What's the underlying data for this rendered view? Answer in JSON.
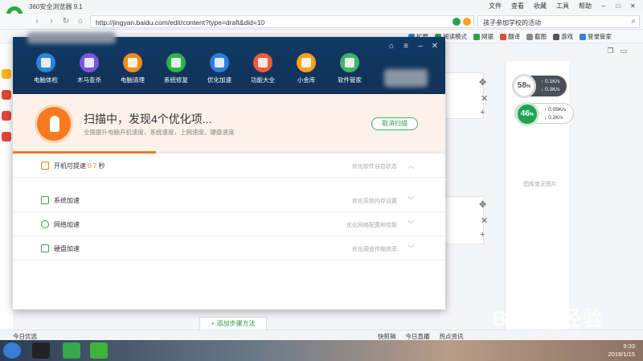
{
  "browser": {
    "title": "360安全浏览器 9.1",
    "menu": [
      "文件",
      "查看",
      "收藏",
      "工具",
      "帮助"
    ],
    "url": "http://jingyan.baidu.com/edit/content?type=draft&did=10",
    "search_text": "孩子参加学校的活动",
    "bookmarks_right": [
      "扩展",
      "阅读模式",
      "网银",
      "翻译",
      "截图",
      "游戏",
      "登录管家"
    ]
  },
  "dialog": {
    "tools": [
      {
        "label": "电脑体检",
        "color": "#2a86d8",
        "icon": "monitor-icon"
      },
      {
        "label": "木马查杀",
        "color": "#7a56e0",
        "icon": "horse-icon"
      },
      {
        "label": "电脑清理",
        "color": "#f08c1e",
        "icon": "broom-icon"
      },
      {
        "label": "系统修复",
        "color": "#2fb34a",
        "icon": "shield-icon"
      },
      {
        "label": "优化加速",
        "color": "#2a7ee0",
        "icon": "rocket-icon"
      },
      {
        "label": "功能大全",
        "color": "#f05a3c",
        "icon": "grid-icon"
      },
      {
        "label": "小金库",
        "color": "#f6a21e",
        "icon": "coin-icon"
      },
      {
        "label": "软件管家",
        "color": "#3fb36a",
        "icon": "apps-icon"
      }
    ],
    "scan_title": "扫描中，发现4个优化项...",
    "scan_subtitle": "全面提升电脑开机速度，系统速度，上网速度，硬盘速度",
    "cancel_label": "取消扫描",
    "progress": 0.33,
    "boot": {
      "label": "开机可提速",
      "value": "0.7",
      "unit": "秒",
      "desc": "优化软件自启状态"
    },
    "rows": [
      {
        "label": "系统加速",
        "desc": "优化系统内存设置"
      },
      {
        "label": "网络加速",
        "desc": "优化网络配置和性能"
      },
      {
        "label": "硬盘加速",
        "desc": "优化硬盘传输效率"
      }
    ]
  },
  "page": {
    "right_placeholder": "图库查无图片",
    "add_step": "+ 添加步骤方法"
  },
  "meters": {
    "cpu": {
      "percent": "58",
      "unit": "%",
      "up": "0.1K/s",
      "down": "0.3K/s"
    },
    "mem": {
      "percent": "46",
      "unit": "%",
      "up": "0.05K/s",
      "down": "0.2K/s"
    }
  },
  "status": {
    "left": "今日优选",
    "right": [
      "快剪辑",
      "今日直播",
      "热点资讯"
    ]
  },
  "taskbar": {
    "time": "9:33",
    "date": "2018/1/15"
  },
  "watermark": {
    "main": "Baidu 经验",
    "sub": "jingyan.baidu.com"
  }
}
